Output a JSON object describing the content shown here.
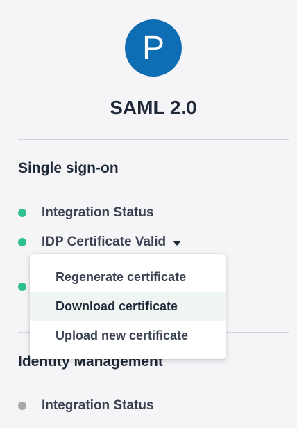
{
  "app": {
    "avatar_letter": "P",
    "title": "SAML 2.0"
  },
  "sso": {
    "heading": "Single sign-on",
    "rows": [
      {
        "label": "Integration Status",
        "status_color": "#2ec08d"
      },
      {
        "label": "IDP Certificate Valid",
        "status_color": "#2ec08d"
      },
      {
        "label": "",
        "status_color": "#2ec08d"
      }
    ]
  },
  "certificate_menu": {
    "items": [
      {
        "label": "Regenerate certificate"
      },
      {
        "label": "Download certificate",
        "highlighted": true
      },
      {
        "label": "Upload new certificate"
      }
    ]
  },
  "identity": {
    "heading": "Identity Management",
    "rows": [
      {
        "label": "Integration Status",
        "status_color": "#a8a8a8"
      }
    ]
  },
  "colors": {
    "accent": "#0e6db3",
    "status_ok": "#2ec08d",
    "status_inactive": "#a8a8a8"
  },
  "icons": {
    "dropdown": "caret-down-icon"
  }
}
